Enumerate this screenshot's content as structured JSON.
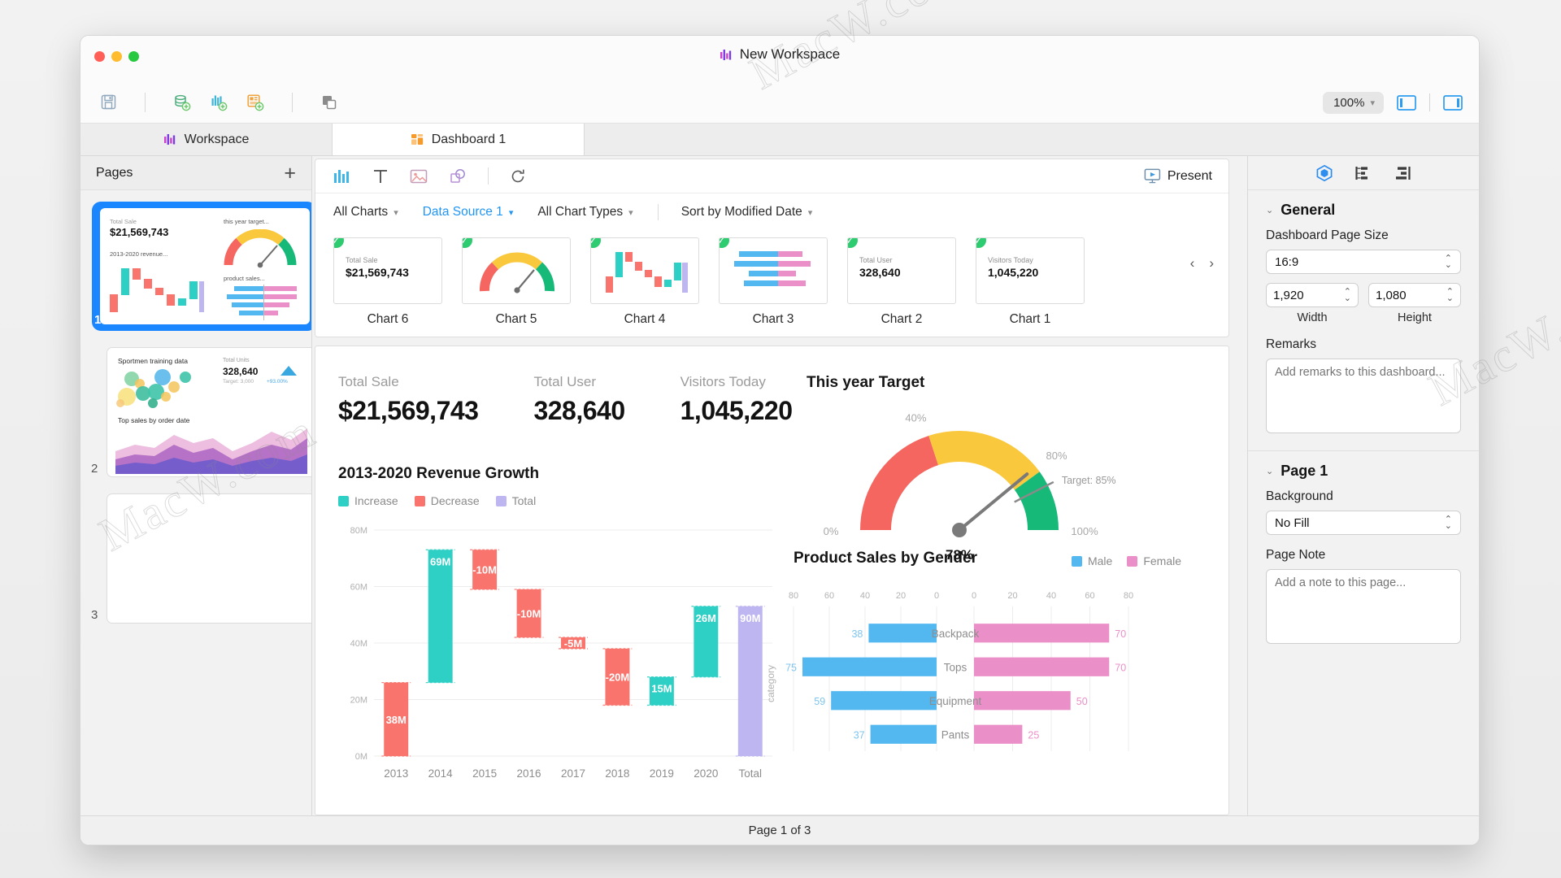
{
  "window": {
    "title": "New Workspace",
    "title_icon": "bar-chart-icon"
  },
  "toolbar": {
    "save_icon": "save-icon",
    "add_data_icon": "add-data-source-icon",
    "add_chart_icon": "add-chart-icon",
    "add_dashboard_icon": "add-dashboard-icon",
    "duplicate_icon": "duplicate-icon",
    "zoom_level": "100%",
    "left_panel_icon": "toggle-left-panel-icon",
    "right_panel_icon": "toggle-right-panel-icon"
  },
  "tabs": [
    {
      "label": "Workspace",
      "icon": "bar-chart-icon",
      "active": false
    },
    {
      "label": "Dashboard 1",
      "icon": "dashboard-grid-icon",
      "active": true
    }
  ],
  "pages_panel": {
    "title": "Pages",
    "add_label": "+",
    "items": [
      {
        "number": "1",
        "selected": true
      },
      {
        "number": "2",
        "selected": false
      },
      {
        "number": "3",
        "selected": false
      }
    ],
    "page1_preview": {
      "kpi_label": "Total Sale",
      "kpi_value": "$21,569,743",
      "gauge_label": "this year target...",
      "waterfall_label": "2013-2020 revenue...",
      "gender_label": "product sales..."
    },
    "page2_preview": {
      "bubble_title": "Sportmen training data",
      "kpi_label": "Total Units",
      "kpi_value": "328,640",
      "kpi_target": "Target: 3,000",
      "kpi_delta": "+93.00%",
      "area_title": "Top sales by order date"
    }
  },
  "chart_bar": {
    "icons": [
      "chart-icon",
      "text-icon",
      "image-icon",
      "shape-icon",
      "refresh-icon"
    ],
    "present_label": "Present",
    "present_icon": "present-icon",
    "filters": [
      {
        "label": "All Charts",
        "active": false
      },
      {
        "label": "Data Source 1",
        "active": true
      },
      {
        "label": "All Chart Types",
        "active": false
      },
      {
        "label": "Sort by Modified Date",
        "active": false
      }
    ],
    "prev_icon": "chevron-left-icon",
    "next_icon": "chevron-right-icon",
    "thumbnails": [
      {
        "name": "Chart 6",
        "kind": "kpi",
        "kpi_label": "Total Sale",
        "kpi_value": "$21,569,743",
        "checked": true
      },
      {
        "name": "Chart 5",
        "kind": "gauge",
        "checked": true
      },
      {
        "name": "Chart 4",
        "kind": "waterfall",
        "checked": true
      },
      {
        "name": "Chart 3",
        "kind": "bars",
        "checked": true
      },
      {
        "name": "Chart 2",
        "kind": "kpi",
        "kpi_label": "Total User",
        "kpi_value": "328,640",
        "checked": true
      },
      {
        "name": "Chart 1",
        "kind": "kpi",
        "kpi_label": "Visitors Today",
        "kpi_value": "1,045,220",
        "checked": true
      }
    ]
  },
  "dashboard": {
    "kpis": [
      {
        "label": "Total Sale",
        "value": "$21,569,743"
      },
      {
        "label": "Total User",
        "value": "328,640"
      },
      {
        "label": "Visitors Today",
        "value": "1,045,220"
      }
    ],
    "waterfall_title": "2013-2020 Revenue Growth",
    "gauge_title": "This year Target",
    "gender_title": "Product Sales by Gender"
  },
  "chart_data": [
    {
      "type": "bar",
      "id": "waterfall",
      "title": "2013-2020 Revenue Growth",
      "xlabel": "",
      "ylabel": "",
      "ylim": [
        0,
        80
      ],
      "ytick_labels": [
        "0M",
        "20M",
        "40M",
        "60M",
        "80M"
      ],
      "yticks": [
        0,
        20,
        40,
        60,
        80
      ],
      "grid": true,
      "legend": [
        "Increase",
        "Decrease",
        "Total"
      ],
      "legend_position": "top-left",
      "colors": {
        "increase": "#2ecfc4",
        "decrease": "#f9746d",
        "total": "#bdb6f0"
      },
      "categories": [
        "2013",
        "2014",
        "2015",
        "2016",
        "2017",
        "2018",
        "2019",
        "2020",
        "Total"
      ],
      "labels": [
        "38M",
        "69M",
        "-10M",
        "-10M",
        "-5M",
        "-20M",
        "15M",
        "26M",
        "90M"
      ],
      "values": [
        38,
        69,
        -10,
        -10,
        -5,
        -20,
        15,
        26,
        90
      ],
      "bar_kinds": [
        "decrease",
        "increase",
        "decrease",
        "decrease",
        "decrease",
        "decrease",
        "increase",
        "increase",
        "total"
      ],
      "bar_spans": [
        {
          "bottom": 0,
          "top": 26
        },
        {
          "bottom": 26,
          "top": 73
        },
        {
          "bottom": 59,
          "top": 73
        },
        {
          "bottom": 42,
          "top": 59
        },
        {
          "bottom": 38,
          "top": 42
        },
        {
          "bottom": 18,
          "top": 38
        },
        {
          "bottom": 18,
          "top": 28
        },
        {
          "bottom": 28,
          "top": 53
        },
        {
          "bottom": 0,
          "top": 53
        }
      ]
    },
    {
      "type": "gauge",
      "id": "gauge",
      "title": "This year Target",
      "value": 78,
      "value_label": "78%",
      "min": 0,
      "max": 100,
      "target": 85,
      "target_label": "Target: 85%",
      "tick_labels": [
        "0%",
        "40%",
        "80%",
        "100%"
      ],
      "ticks": [
        0,
        40,
        80,
        100
      ],
      "bands": [
        {
          "from": 0,
          "to": 40,
          "color": "#f4665f"
        },
        {
          "from": 40,
          "to": 80,
          "color": "#fac83c"
        },
        {
          "from": 80,
          "to": 100,
          "color": "#17b978"
        }
      ]
    },
    {
      "type": "bar",
      "id": "gender",
      "title": "Product Sales by Gender",
      "orientation": "horizontal-butterfly",
      "ylabel": "category",
      "categories": [
        "Backpack",
        "Tops",
        "Equipment",
        "Pants"
      ],
      "left_ticks": [
        "80",
        "60",
        "40",
        "20",
        "0"
      ],
      "right_ticks": [
        "0",
        "20",
        "40",
        "60",
        "80"
      ],
      "xlim": [
        0,
        80
      ],
      "grid": true,
      "legend": [
        "Male",
        "Female"
      ],
      "legend_position": "top-right",
      "colors": {
        "male": "#54b8f0",
        "female": "#eb8fc8"
      },
      "series": [
        {
          "name": "Male",
          "values": [
            38,
            75,
            59,
            37
          ]
        },
        {
          "name": "Female",
          "values": [
            70,
            70,
            50,
            25
          ]
        }
      ]
    }
  ],
  "inspector": {
    "tab_icons": [
      "properties-cube-icon",
      "layers-icon",
      "align-icon"
    ],
    "general": {
      "title": "General",
      "page_size_label": "Dashboard Page Size",
      "page_size_value": "16:9",
      "width_value": "1,920",
      "width_caption": "Width",
      "height_value": "1,080",
      "height_caption": "Height",
      "remarks_label": "Remarks",
      "remarks_placeholder": "Add remarks to this dashboard..."
    },
    "page": {
      "title": "Page 1",
      "background_label": "Background",
      "background_value": "No Fill",
      "note_label": "Page Note",
      "note_placeholder": "Add a note to this page..."
    }
  },
  "statusbar": {
    "text": "Page 1 of 3"
  },
  "watermarks": [
    "MacW.com",
    "MacW.com",
    "MacW.c"
  ]
}
